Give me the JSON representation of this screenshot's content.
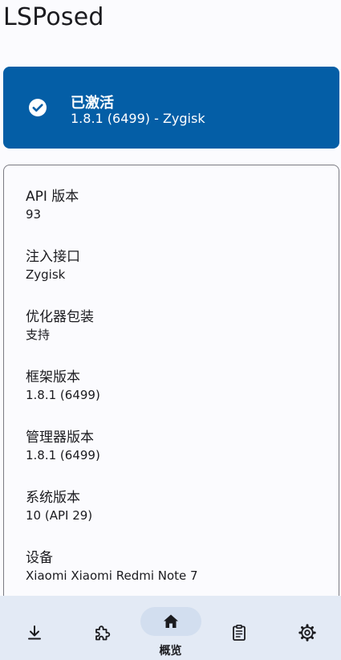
{
  "app": {
    "title": "LSPosed"
  },
  "status": {
    "title": "已激活",
    "subtitle": "1.8.1 (6499) - Zygisk",
    "icon": "check-circle-icon",
    "color": "#045ea6"
  },
  "info": {
    "items": [
      {
        "label": "API 版本",
        "value": "93"
      },
      {
        "label": "注入接口",
        "value": "Zygisk"
      },
      {
        "label": "优化器包装",
        "value": "支持"
      },
      {
        "label": "框架版本",
        "value": "1.8.1 (6499)"
      },
      {
        "label": "管理器版本",
        "value": "1.8.1 (6499)"
      },
      {
        "label": "系统版本",
        "value": "10 (API 29)"
      },
      {
        "label": "设备",
        "value": "Xiaomi Xiaomi Redmi Note 7"
      }
    ]
  },
  "nav": {
    "items": [
      {
        "icon": "download-icon",
        "label": ""
      },
      {
        "icon": "puzzle-icon",
        "label": ""
      },
      {
        "icon": "home-icon",
        "label": "概览",
        "selected": true
      },
      {
        "icon": "clipboard-icon",
        "label": ""
      },
      {
        "icon": "gear-icon",
        "label": ""
      }
    ]
  }
}
